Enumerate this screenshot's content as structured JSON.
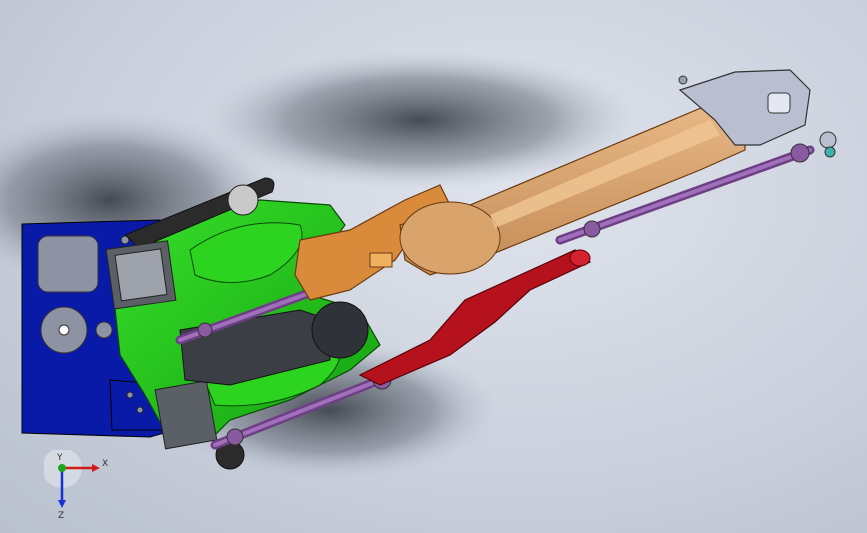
{
  "viewport": {
    "background": "#cfd5e0",
    "shadow_color": "#4a4f58"
  },
  "model": {
    "colors": {
      "base_blue": "#0a1aa8",
      "base_grey": "#8d93a3",
      "frame_green": "#22c81a",
      "arm_tan": "#d4a06a",
      "arm_orange": "#d98a3a",
      "link_red": "#b5121e",
      "rod_purple": "#8a5aa0",
      "wrist_grey": "#b9bfd0",
      "belt_black": "#2b2b2b"
    }
  },
  "triad": {
    "x_label": "X",
    "y_label": "Y",
    "z_label": "Z",
    "x_color": "#d11b1b",
    "y_color": "#1aa81a",
    "z_color": "#1a2fd1"
  }
}
